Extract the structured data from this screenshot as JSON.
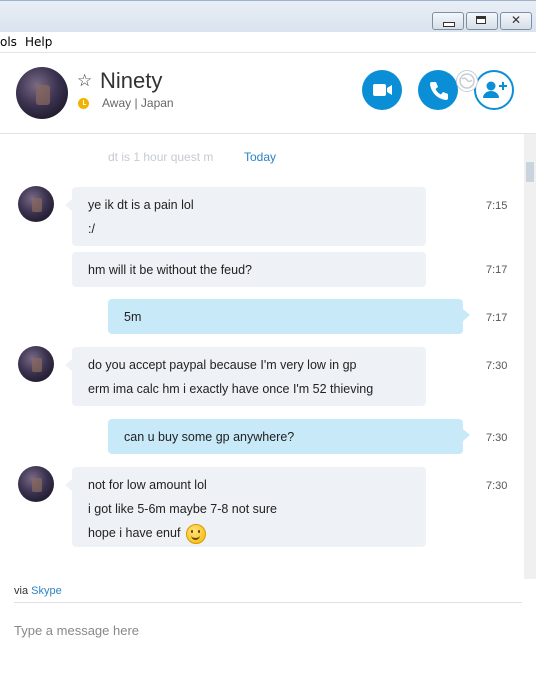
{
  "menu": {
    "tools": "ols",
    "help": "Help"
  },
  "window_buttons": {
    "close_glyph": "✕"
  },
  "contact": {
    "name": "Ninety",
    "status": "Away",
    "location": "Japan",
    "status_text": "Away | Japan"
  },
  "icons": {
    "favorite": "star-icon",
    "video": "video-icon",
    "call": "phone-icon",
    "add": "add-person-icon",
    "globe": "globe-icon"
  },
  "colors": {
    "accent": "#0a8fd6",
    "away": "#f2b300",
    "incoming_bubble": "#eef1f5",
    "outgoing_bubble": "#c7e9f8",
    "link": "#2b84c4"
  },
  "chat": {
    "ghost_text": "dt is 1 hour quest m",
    "date_separator": "Today",
    "messages": [
      {
        "direction": "in",
        "lines": [
          "ye ik dt is a pain lol",
          ":/"
        ],
        "time": "7:15"
      },
      {
        "direction": "in",
        "lines": [
          "hm will it be without the feud?"
        ],
        "time": "7:17"
      },
      {
        "direction": "out",
        "lines": [
          "5m"
        ],
        "time": "7:17"
      },
      {
        "direction": "in",
        "lines": [
          "do you accept paypal because I'm very low in gp",
          "erm ima calc hm i exactly have once I'm 52 thieving"
        ],
        "time": "7:30"
      },
      {
        "direction": "out",
        "lines": [
          "can u buy some gp anywhere?"
        ],
        "time": "7:30"
      },
      {
        "direction": "in",
        "lines": [
          "not for low amount lol",
          "i got like 5-6m maybe 7-8 not sure",
          "hope i have enuf"
        ],
        "time": "7:30"
      }
    ]
  },
  "footer": {
    "via_prefix": "via",
    "via_link": "Skype",
    "compose_placeholder": "Type a message here"
  }
}
